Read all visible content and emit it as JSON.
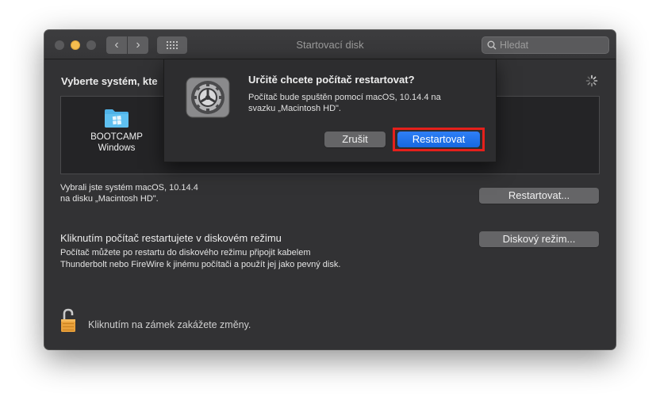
{
  "window": {
    "title": "Startovací disk"
  },
  "search": {
    "placeholder": "Hledat"
  },
  "main": {
    "heading": "Vyberte systém, kte",
    "disks": [
      {
        "name": "BOOTCAMP",
        "sub": "Windows"
      }
    ],
    "selected_info_line1": "Vybrali jste systém macOS, 10.14.4",
    "selected_info_line2": "na disku „Macintosh HD\".",
    "restart_button": "Restartovat...",
    "disk_mode_title": "Kliknutím počítač restartujete v diskovém režimu",
    "disk_mode_desc_line1": "Počítač můžete po restartu do diskového režimu připojit kabelem",
    "disk_mode_desc_line2": "Thunderbolt nebo FireWire k jinému počítači a použít jej jako pevný disk.",
    "disk_mode_button": "Diskový režim...",
    "lock_text": "Kliknutím na zámek zakážete změny."
  },
  "dialog": {
    "title": "Určitě chcete počítač restartovat?",
    "message_line1": "Počítač bude spuštěn pomocí macOS, 10.14.4 na",
    "message_line2": "svazku „Macintosh HD\".",
    "cancel_label": "Zrušit",
    "confirm_label": "Restartovat"
  },
  "colors": {
    "accent": "#1a6ee6",
    "highlight": "#e5201b",
    "window_bg": "#323234",
    "folder": "#4fb3e8"
  }
}
